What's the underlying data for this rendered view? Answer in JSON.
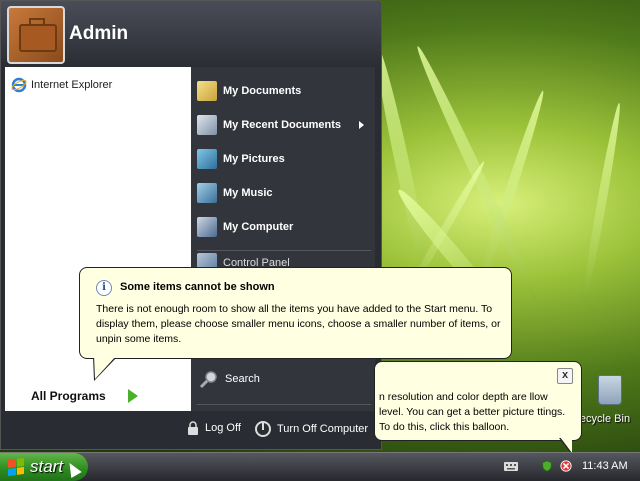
{
  "start_menu": {
    "user_name": "Admin",
    "pinned": [
      {
        "label": "Internet Explorer",
        "icon": "internet-explorer-icon"
      }
    ],
    "all_programs_label": "All Programs",
    "right_items": [
      {
        "label": "My Documents",
        "icon": "my-documents-icon",
        "submenu": false
      },
      {
        "label": "My Recent Documents",
        "icon": "recent-documents-icon",
        "submenu": true
      },
      {
        "label": "My Pictures",
        "icon": "my-pictures-icon",
        "submenu": false
      },
      {
        "label": "My Music",
        "icon": "my-music-icon",
        "submenu": false
      },
      {
        "label": "My Computer",
        "icon": "my-computer-icon",
        "submenu": false
      }
    ],
    "partial_item": "Control Panel",
    "search_label": "Search",
    "log_off_label": "Log Off",
    "turn_off_label": "Turn Off Computer"
  },
  "balloon_main": {
    "title": "Some items cannot be shown",
    "body": "There is not enough room to show all the items you have added to the Start menu. To display them, please choose smaller menu icons, choose a smaller number of items, or unpin some items."
  },
  "balloon_tray": {
    "body": "n resolution and color depth are llow level. You can get a better picture ttings. To do this, click this balloon.",
    "close_label": "x"
  },
  "desktop": {
    "recycle_bin_label": "ecycle Bin"
  },
  "taskbar": {
    "start_label": "start",
    "clock": "11:43 AM"
  },
  "colors": {
    "start_green": "#2b8a1e",
    "balloon_bg": "#ffffe1",
    "menu_dark": "#2a2c33"
  }
}
